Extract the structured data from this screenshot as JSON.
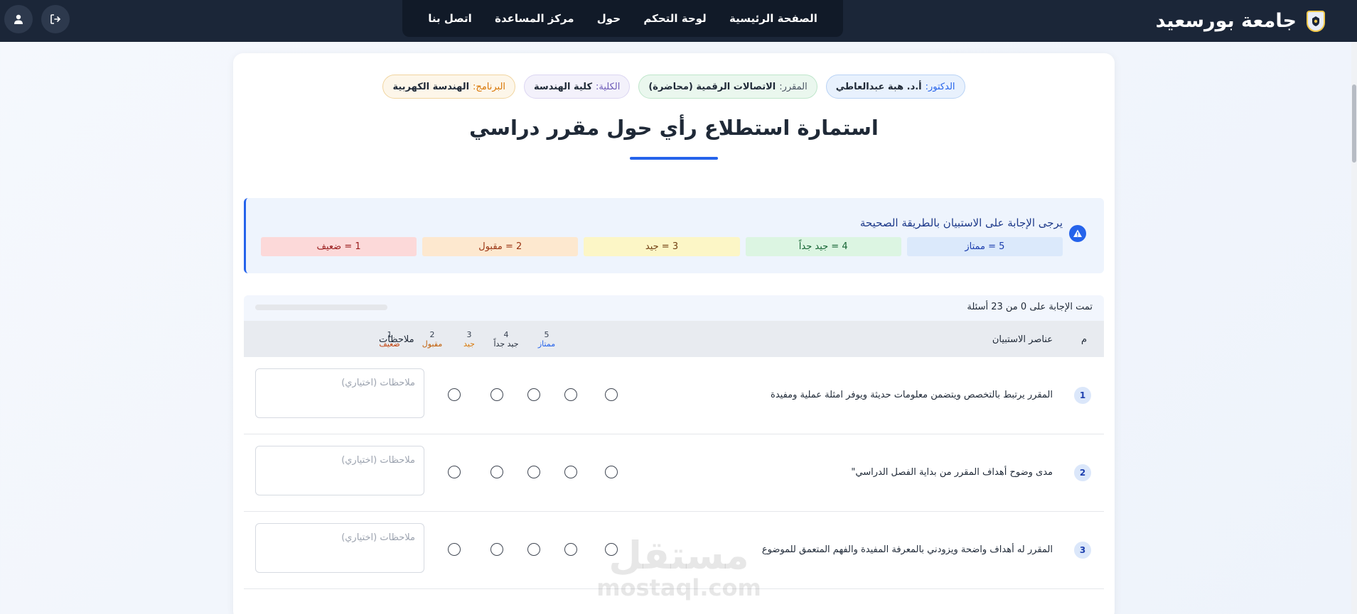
{
  "navbar": {
    "brand_name": "جامعة بورسعيد",
    "links": [
      "الصفحة الرئيسية",
      "لوحة التحكم",
      "حول",
      "مركز المساعدة",
      "اتصل بنا"
    ]
  },
  "info_chips": {
    "doctor": {
      "label": "الدكتور:",
      "value": "أ.د. هبة عبدالعاطي"
    },
    "course": {
      "label": "المقرر:",
      "value": "الاتصالات الرقمية (محاضرة)"
    },
    "college": {
      "label": "الكلية:",
      "value": "كلية الهندسة"
    },
    "program": {
      "label": "البرنامج:",
      "value": "الهندسة الكهربية"
    }
  },
  "page_title": "استمارة استطلاع رأي حول مقرر دراسي",
  "instructions": {
    "title": "يرجى الإجابة على الاستبيان بالطريقة الصحيحة",
    "scale": [
      "5 = ممتاز",
      "4 = جيد جداً",
      "3 = جيد",
      "2 = مقبول",
      "1 = ضعيف"
    ]
  },
  "progress": {
    "text": "تمت الإجابة على 0 من 23 أسئلة",
    "answered": 0,
    "total": 23
  },
  "table_header": {
    "num": "م",
    "items": "عناصر الاستبيان",
    "notes": "ملاحظات",
    "ratings": [
      {
        "n": "5",
        "label": "ممتاز"
      },
      {
        "n": "4",
        "label": "جيد جداً"
      },
      {
        "n": "3",
        "label": "جيد"
      },
      {
        "n": "2",
        "label": "مقبول"
      },
      {
        "n": "1",
        "label": "ضعيف"
      }
    ]
  },
  "questions": [
    {
      "num": "1",
      "text": "المقرر يرتبط بالتخصص ويتضمن معلومات حديثة ويوفر امثلة عملية ومفيدة",
      "notes_placeholder": "ملاحظات (اختياري)"
    },
    {
      "num": "2",
      "text": "مدى وضوح أهداف المقرر من بداية الفصل الدراسي\"",
      "notes_placeholder": "ملاحظات (اختياري)"
    },
    {
      "num": "3",
      "text": "المقرر له أهداف واضحة ويزودني بالمعرفة المفيدة والفهم المتعمق للموضوع",
      "notes_placeholder": "ملاحظات (اختياري)"
    }
  ],
  "watermark": {
    "ar": "مستقل",
    "en": "mostaql.com"
  },
  "colors": {
    "navbar": "#1b2638",
    "accent": "#2563eb",
    "rating_5": "#2563eb",
    "rating_4": "#1f2937",
    "rating_3": "#d97706",
    "rating_2": "#c2610c",
    "rating_1": "#c2410c"
  },
  "icons": {
    "brand": "university-crest-icon",
    "user": "user-icon",
    "logout": "logout-icon",
    "warning": "warning-icon"
  }
}
